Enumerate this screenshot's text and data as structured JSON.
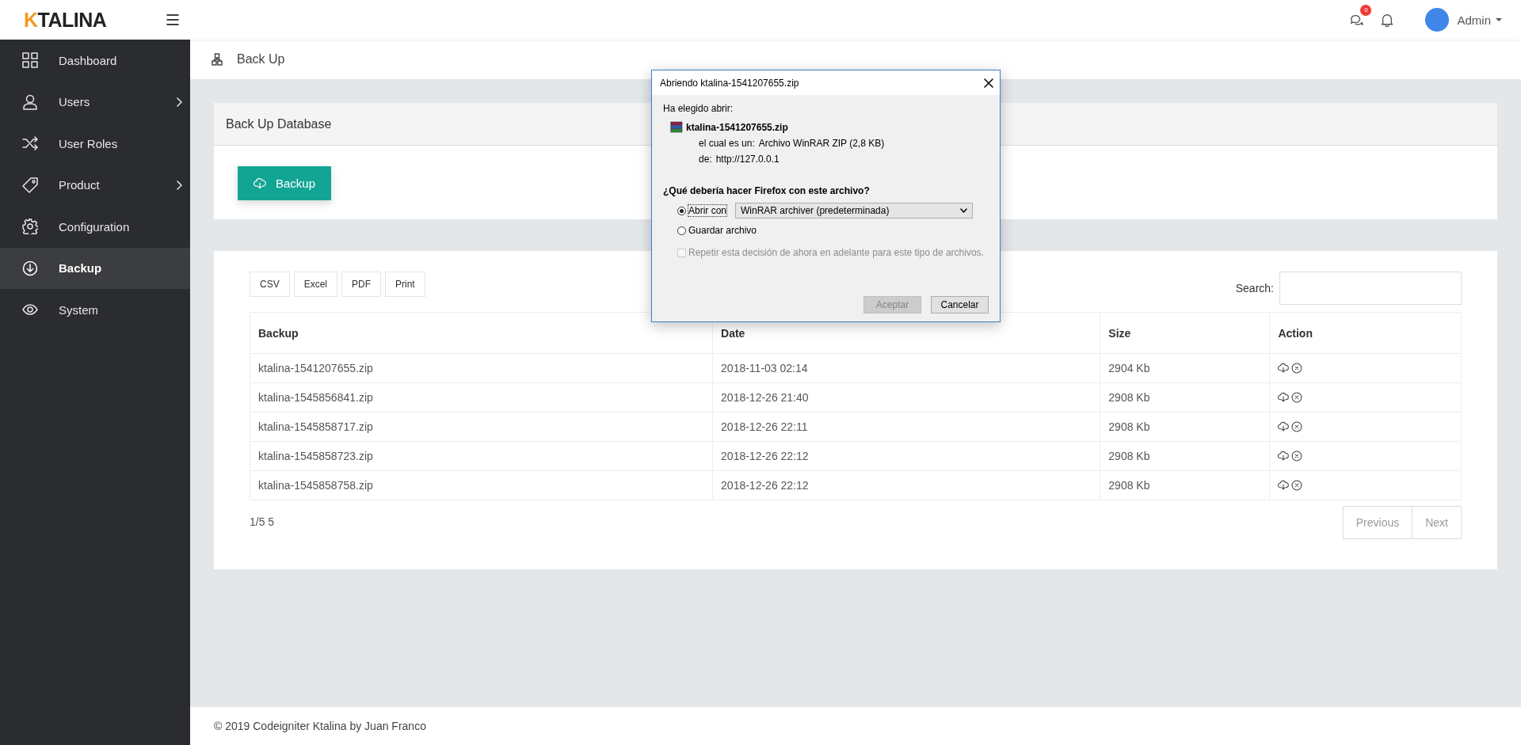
{
  "header": {
    "logo": {
      "accent": "K",
      "rest": "TALINA"
    },
    "messages_badge": "0",
    "user": "Admin"
  },
  "sidebar": {
    "items": [
      {
        "label": "Dashboard",
        "has_submenu": false,
        "selected": false
      },
      {
        "label": "Users",
        "has_submenu": true,
        "selected": false
      },
      {
        "label": "User Roles",
        "has_submenu": false,
        "selected": false
      },
      {
        "label": "Product",
        "has_submenu": true,
        "selected": false
      },
      {
        "label": "Configuration",
        "has_submenu": false,
        "selected": false
      },
      {
        "label": "Backup",
        "has_submenu": false,
        "selected": true
      },
      {
        "label": "System",
        "has_submenu": false,
        "selected": false
      }
    ]
  },
  "breadcrumb": {
    "title": "Back Up"
  },
  "backup_card": {
    "title": "Back Up Database",
    "button": "Backup"
  },
  "table_card": {
    "export_buttons": [
      "CSV",
      "Excel",
      "PDF",
      "Print"
    ],
    "search_label": "Search:",
    "columns": [
      "Backup",
      "Date",
      "Size",
      "Action"
    ],
    "rows": [
      {
        "backup": "ktalina-1541207655.zip",
        "date": "2018-11-03 02:14",
        "size": "2904 Kb"
      },
      {
        "backup": "ktalina-1545856841.zip",
        "date": "2018-12-26 21:40",
        "size": "2908 Kb"
      },
      {
        "backup": "ktalina-1545858717.zip",
        "date": "2018-12-26 22:11",
        "size": "2908 Kb"
      },
      {
        "backup": "ktalina-1545858723.zip",
        "date": "2018-12-26 22:12",
        "size": "2908 Kb"
      },
      {
        "backup": "ktalina-1545858758.zip",
        "date": "2018-12-26 22:12",
        "size": "2908 Kb"
      }
    ],
    "info": "1/5 5",
    "pagination": [
      {
        "label": "Previous",
        "disabled": true
      },
      {
        "label": "Next",
        "disabled": true
      }
    ]
  },
  "footer": "© 2019 Codeigniter Ktalina by Juan Franco",
  "dialog": {
    "title": "Abriendo ktalina-1541207655.zip",
    "intro": "Ha elegido abrir:",
    "filename": "ktalina-1541207655.zip",
    "type_label": "el cual es un:",
    "type_value": "Archivo WinRAR ZIP (2,8 KB)",
    "from_label": "de:",
    "from_value": "http://127.0.0.1",
    "question": "¿Qué debería hacer Firefox con este archivo?",
    "options": [
      {
        "label": "Abrir con",
        "selected": true
      },
      {
        "label": "Guardar archivo",
        "selected": false
      }
    ],
    "app_select": "WinRAR archiver (predeterminada)",
    "remember": {
      "label": "Repetir esta decisión de ahora en adelante para este tipo de archivos.",
      "checked": false,
      "disabled": true
    },
    "buttons": [
      {
        "label": "Aceptar",
        "disabled": true
      },
      {
        "label": "Cancelar",
        "disabled": false
      }
    ]
  }
}
